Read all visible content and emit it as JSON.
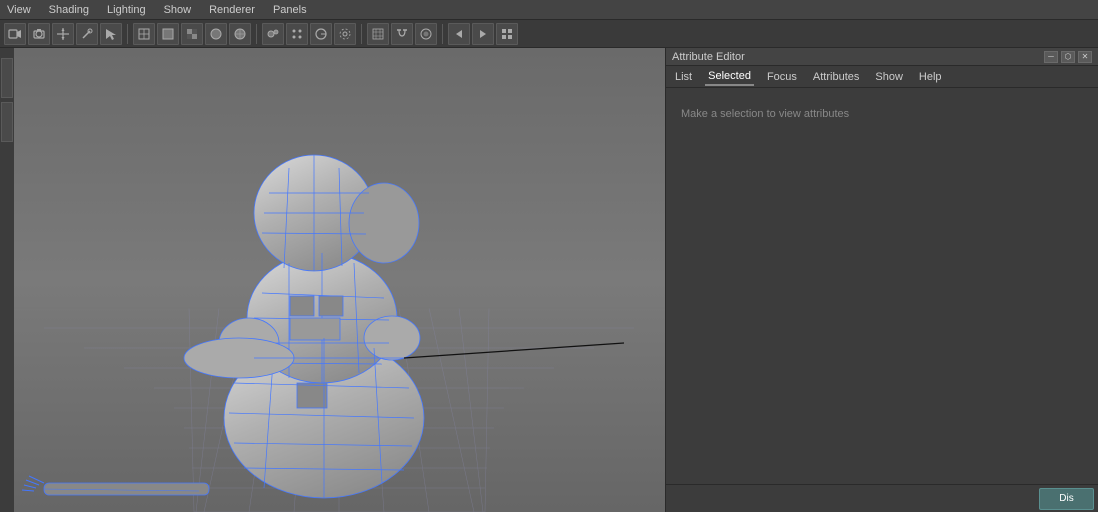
{
  "menu": {
    "items": [
      "View",
      "Shading",
      "Lighting",
      "Show",
      "Renderer",
      "Panels"
    ]
  },
  "toolbar": {
    "buttons": [
      {
        "name": "film-icon",
        "label": "🎬"
      },
      {
        "name": "camera-icon",
        "label": "📷"
      },
      {
        "name": "move-icon",
        "label": "✥"
      },
      {
        "name": "paint-icon",
        "label": "🖌"
      },
      {
        "name": "select-icon",
        "label": "▶"
      },
      {
        "name": "grid-icon",
        "label": "⊞"
      },
      {
        "name": "box-icon",
        "label": "◻"
      },
      {
        "name": "poly-icon",
        "label": "⬡"
      },
      {
        "name": "sphere-icon",
        "label": "⬤"
      },
      {
        "name": "cylinder-icon",
        "label": "⬜"
      },
      {
        "name": "curve-icon",
        "label": "〜"
      },
      {
        "name": "rotate-icon",
        "label": "↻"
      },
      {
        "name": "scale-icon",
        "label": "⤡"
      },
      {
        "name": "light-icon",
        "label": "☀"
      },
      {
        "name": "snap-icon",
        "label": "🔲"
      },
      {
        "name": "render-icon",
        "label": "▶"
      }
    ]
  },
  "attribute_editor": {
    "title": "Attribute Editor",
    "menu_items": [
      {
        "label": "List",
        "active": false
      },
      {
        "label": "Selected",
        "active": true
      },
      {
        "label": "Focus",
        "active": false
      },
      {
        "label": "Attributes",
        "active": false
      },
      {
        "label": "Show",
        "active": false
      },
      {
        "label": "Help",
        "active": false
      }
    ],
    "hint_text": "Make a selection to view attributes",
    "title_buttons": [
      "-",
      "⬡",
      "✕"
    ]
  },
  "viewport": {
    "grid_color": "#666666",
    "bg_color": "#787878",
    "model_color": "#aaaaaa"
  },
  "bottom": {
    "button_label": "Dis"
  },
  "colors": {
    "bg_dark": "#3c3c3c",
    "bg_mid": "#444444",
    "bg_light": "#4a4a4a",
    "border": "#2a2a2a",
    "text": "#cccccc",
    "text_dim": "#888888",
    "accent_teal": "#4a8080"
  }
}
